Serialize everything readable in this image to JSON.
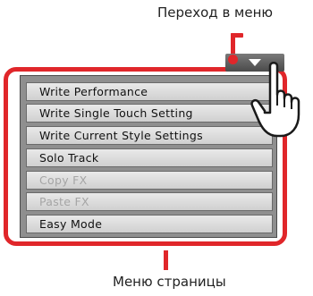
{
  "callouts": {
    "menu_button_label": "Переход в меню",
    "page_menu_label": "Меню страницы"
  },
  "colors": {
    "highlight": "#e0262a",
    "menu_item_bg": "#dcdcdc",
    "menu_panel_bg": "#8f8f8f",
    "disabled_text": "#a5a5a5"
  },
  "menu_trigger": {
    "icon": "triangle-down-icon"
  },
  "menu": {
    "items": [
      {
        "label": "Write Performance",
        "enabled": true
      },
      {
        "label": "Write Single Touch Setting",
        "enabled": true
      },
      {
        "label": "Write Current Style Settings",
        "enabled": true
      },
      {
        "label": "Solo Track",
        "enabled": true
      },
      {
        "label": "Copy FX",
        "enabled": false
      },
      {
        "label": "Paste FX",
        "enabled": false
      },
      {
        "label": "Easy Mode",
        "enabled": true
      }
    ]
  },
  "pointer": {
    "icon": "hand-pointer-icon"
  }
}
